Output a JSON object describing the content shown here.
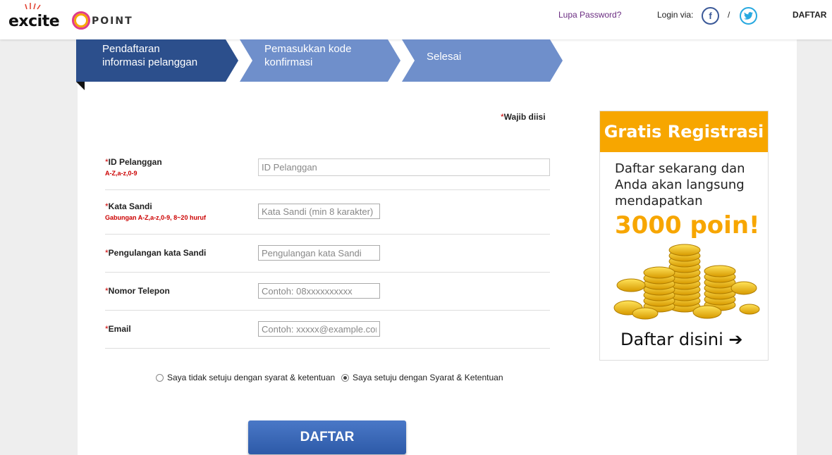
{
  "header": {
    "logo_text": "excite",
    "logo_sub": "POINT",
    "forgot_password": "Lupa Password?",
    "login_via": "Login via:",
    "social_separator": "/",
    "facebook_icon": "facebook-icon",
    "twitter_icon": "twitter-icon",
    "register_link": "DAFTAR"
  },
  "steps": [
    {
      "label_line1": "Pendaftaran",
      "label_line2": "informasi pelanggan",
      "active": true
    },
    {
      "label_line1": "Pemasukkan kode",
      "label_line2": "konfirmasi",
      "active": false
    },
    {
      "label_line1": "Selesai",
      "label_line2": "",
      "active": false
    }
  ],
  "colors": {
    "step_active": "#2c4f8c",
    "step_inactive": "#6f8fcb",
    "accent_orange": "#f7a600",
    "required_red": "#cc0000",
    "button_blue": "#2d5aa8"
  },
  "form": {
    "required_star": "*",
    "required_note": "Wajib diisi",
    "fields": [
      {
        "label": "ID Pelanggan",
        "hint": "A-Z,a-z,0-9",
        "placeholder": "ID Pelanggan",
        "value": ""
      },
      {
        "label": "Kata Sandi",
        "hint": "Gabungan A-Z,a-z,0-9, 8~20 huruf",
        "placeholder": "Kata Sandi (min 8 karakter)",
        "value": ""
      },
      {
        "label": "Pengulangan kata Sandi",
        "hint": "",
        "placeholder": "Pengulangan kata Sandi",
        "value": ""
      },
      {
        "label": "Nomor Telepon",
        "hint": "",
        "placeholder": "Contoh: 08xxxxxxxxxx",
        "value": ""
      },
      {
        "label": "Email",
        "hint": "",
        "placeholder": "Contoh: xxxxx@example.com",
        "value": ""
      }
    ],
    "agree_options": [
      {
        "label": "Saya tidak setuju dengan syarat & ketentuan",
        "checked": false
      },
      {
        "label": "Saya setuju dengan Syarat & Ketentuan",
        "checked": true
      }
    ],
    "submit_label": "DAFTAR"
  },
  "promo": {
    "title": "Gratis Registrasi",
    "body_line1": "Daftar sekarang dan",
    "body_line2": "Anda akan langsung",
    "body_line3": "mendapatkan",
    "points": "3000 poin!",
    "image": "gold-coins",
    "cta": "Daftar disini",
    "cta_icon": "arrow-right-icon"
  }
}
